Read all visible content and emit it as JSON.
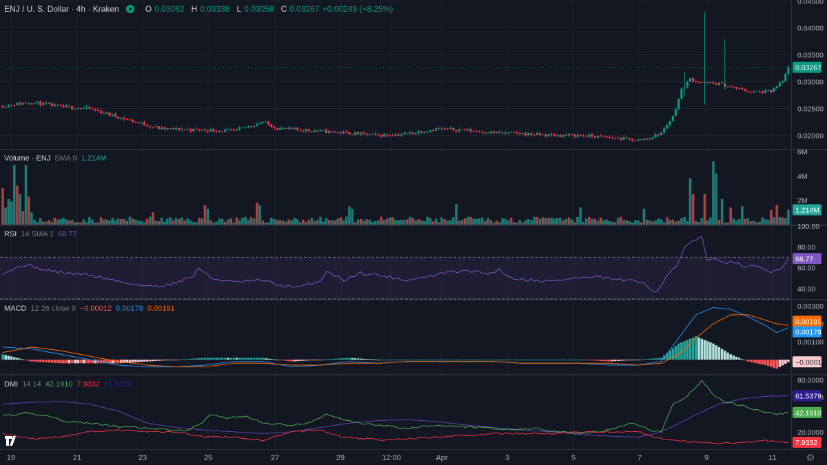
{
  "header": {
    "symbol": "ENJ / U. S. Dollar · 4h · Kraken",
    "o_label": "O",
    "o_value": "0.03062",
    "h_label": "H",
    "h_value": "0.03338",
    "l_label": "L",
    "l_value": "0.03058",
    "c_label": "C",
    "c_value": "0.03267",
    "change": "+0.00249 (+8.25%)"
  },
  "volume_header": {
    "title": "Volume · ENJ",
    "params": "SMA 9",
    "value": "1.214M"
  },
  "rsi_header": {
    "title": "RSI",
    "params": "14 SMA 1",
    "value": "68.77"
  },
  "macd_header": {
    "title": "MACD",
    "params": "12 26 close 9",
    "v1": "−0.00012",
    "v2": "0.00178",
    "v3": "0.00191"
  },
  "dmi_header": {
    "title": "DMI",
    "params": "14 14",
    "v1": "42.1910",
    "v2": "7.9332",
    "v3": "61.5379"
  },
  "colors": {
    "up": "#26a69a",
    "down": "#ef5350",
    "up_candle": "#089981",
    "down_candle": "#f23645",
    "rsi": "#7e57c2",
    "macd": "#2196f3",
    "signal": "#ff6d00",
    "adx": "#311b92",
    "diplus": "#4caf50",
    "diminus": "#f23645"
  },
  "icons": {
    "logo": "tradingview-logo-icon",
    "settings": "gear-icon"
  },
  "chart_data": [
    {
      "type": "candlestick",
      "name": "price",
      "y_axis_ticks": [
        "0.04500",
        "0.04000",
        "0.03500",
        "0.03000",
        "0.02500",
        "0.02000"
      ],
      "ylim": [
        0.0175,
        0.0452
      ],
      "last_price_label": "0.03267",
      "last_price": 0.03267,
      "anchors": [
        [
          0,
          0.0255
        ],
        [
          10,
          0.0262
        ],
        [
          20,
          0.0253
        ],
        [
          30,
          0.025
        ],
        [
          40,
          0.0234
        ],
        [
          55,
          0.0212
        ],
        [
          70,
          0.021
        ],
        [
          80,
          0.0208
        ],
        [
          90,
          0.0225
        ],
        [
          95,
          0.0213
        ],
        [
          110,
          0.0208
        ],
        [
          120,
          0.0204
        ],
        [
          130,
          0.02
        ],
        [
          140,
          0.0203
        ],
        [
          150,
          0.0212
        ],
        [
          160,
          0.021
        ],
        [
          170,
          0.0205
        ],
        [
          180,
          0.0203
        ],
        [
          190,
          0.02
        ],
        [
          200,
          0.02
        ],
        [
          210,
          0.0196
        ],
        [
          220,
          0.0191
        ],
        [
          224,
          0.0195
        ],
        [
          228,
          0.0205
        ],
        [
          232,
          0.0235
        ],
        [
          235,
          0.0285
        ],
        [
          238,
          0.0305
        ],
        [
          242,
          0.0298
        ],
        [
          248,
          0.0296
        ],
        [
          252,
          0.029
        ],
        [
          260,
          0.028
        ],
        [
          266,
          0.0282
        ],
        [
          270,
          0.03
        ],
        [
          272,
          0.0327
        ]
      ],
      "extra_wicks": [
        [
          236,
          0.0318,
          0.0272
        ],
        [
          243,
          0.043,
          0.0258
        ],
        [
          250,
          0.0378,
          0.0285
        ]
      ]
    },
    {
      "type": "bar",
      "name": "volume",
      "y_axis_ticks": [
        "6M",
        "4M",
        "2M"
      ],
      "ylim": [
        0,
        6000000
      ],
      "last_value_label": "1.214M",
      "values_pattern_m": [
        2.8,
        1.4,
        2.1,
        1.7,
        4.9,
        3.2,
        2.5,
        1.1,
        0.9,
        0.7,
        0.5,
        0.4
      ],
      "spikes_m": [
        [
          0,
          3.0
        ],
        [
          3,
          1.9
        ],
        [
          8,
          4.9
        ],
        [
          9,
          2.3
        ],
        [
          10,
          1.0
        ],
        [
          52,
          1.0
        ],
        [
          70,
          1.6
        ],
        [
          71,
          1.3
        ],
        [
          88,
          1.8
        ],
        [
          89,
          1.6
        ],
        [
          120,
          1.5
        ],
        [
          121,
          1.3
        ],
        [
          157,
          1.7
        ],
        [
          200,
          1.4
        ],
        [
          222,
          1.3
        ],
        [
          238,
          3.8
        ],
        [
          239,
          2.5
        ],
        [
          243,
          2.5
        ],
        [
          246,
          5.2
        ],
        [
          247,
          4.2
        ],
        [
          249,
          2.1
        ],
        [
          252,
          1.4
        ],
        [
          256,
          1.5
        ],
        [
          266,
          1.2
        ],
        [
          268,
          1.6
        ],
        [
          272,
          1.214
        ]
      ]
    },
    {
      "type": "line",
      "name": "RSI",
      "y_axis_ticks": [
        "100.00",
        "80.00",
        "60.00",
        "40.00"
      ],
      "ylim": [
        0,
        100
      ],
      "band": [
        30,
        70
      ],
      "last_value_label": "68.77",
      "anchors": [
        [
          0,
          55
        ],
        [
          4,
          59
        ],
        [
          8,
          63
        ],
        [
          14,
          58
        ],
        [
          22,
          55
        ],
        [
          30,
          53
        ],
        [
          40,
          47
        ],
        [
          50,
          42
        ],
        [
          58,
          44
        ],
        [
          66,
          52
        ],
        [
          68,
          60
        ],
        [
          72,
          50
        ],
        [
          80,
          46
        ],
        [
          90,
          48
        ],
        [
          96,
          43
        ],
        [
          102,
          41
        ],
        [
          110,
          47
        ],
        [
          112,
          57
        ],
        [
          118,
          48
        ],
        [
          124,
          55
        ],
        [
          132,
          52
        ],
        [
          140,
          48
        ],
        [
          148,
          52
        ],
        [
          155,
          56
        ],
        [
          162,
          57
        ],
        [
          168,
          54
        ],
        [
          172,
          58
        ],
        [
          176,
          50
        ],
        [
          184,
          48
        ],
        [
          190,
          47
        ],
        [
          198,
          50
        ],
        [
          206,
          51
        ],
        [
          214,
          48
        ],
        [
          222,
          46
        ],
        [
          226,
          36
        ],
        [
          230,
          52
        ],
        [
          234,
          64
        ],
        [
          236,
          79
        ],
        [
          239,
          85
        ],
        [
          242,
          90
        ],
        [
          244,
          68
        ],
        [
          248,
          67
        ],
        [
          252,
          65
        ],
        [
          256,
          62
        ],
        [
          262,
          60
        ],
        [
          266,
          55
        ],
        [
          270,
          61
        ],
        [
          272,
          68.77
        ]
      ]
    },
    {
      "type": "line+bar",
      "name": "MACD",
      "y_axis_ticks": [
        "0.00300",
        "0.00200",
        "0.00100"
      ],
      "ylim": [
        -0.0008,
        0.0033
      ],
      "last_value_labels": [
        "0.00191",
        "0.00178",
        "−0.00012"
      ],
      "macd_last": 0.00178,
      "signal_last": 0.00191,
      "hist_last": -0.00012,
      "macd_anchors": [
        [
          0,
          0.0007
        ],
        [
          10,
          0.0006
        ],
        [
          20,
          0.0003
        ],
        [
          30,
          0.0
        ],
        [
          40,
          -0.0003
        ],
        [
          50,
          -0.0004
        ],
        [
          60,
          -0.0004
        ],
        [
          70,
          -0.0003
        ],
        [
          80,
          -0.0001
        ],
        [
          90,
          -0.0001
        ],
        [
          100,
          -0.0004
        ],
        [
          110,
          -0.0003
        ],
        [
          120,
          -0.0001
        ],
        [
          130,
          -0.0002
        ],
        [
          140,
          -0.0001
        ],
        [
          150,
          -0.0001
        ],
        [
          160,
          -0.0001
        ],
        [
          170,
          -0.0001
        ],
        [
          180,
          -0.0002
        ],
        [
          190,
          -0.0002
        ],
        [
          200,
          -0.0002
        ],
        [
          210,
          -0.0003
        ],
        [
          220,
          -0.0003
        ],
        [
          228,
          -0.0001
        ],
        [
          234,
          0.0012
        ],
        [
          240,
          0.0025
        ],
        [
          246,
          0.0029
        ],
        [
          252,
          0.0028
        ],
        [
          258,
          0.0024
        ],
        [
          264,
          0.0019
        ],
        [
          268,
          0.0015
        ],
        [
          272,
          0.00178
        ]
      ],
      "signal_anchors": [
        [
          0,
          0.0004
        ],
        [
          10,
          0.0007
        ],
        [
          20,
          0.0005
        ],
        [
          30,
          0.0002
        ],
        [
          40,
          -0.0001
        ],
        [
          50,
          -0.0003
        ],
        [
          60,
          -0.0004
        ],
        [
          70,
          -0.0004
        ],
        [
          80,
          -0.0002
        ],
        [
          90,
          -0.0002
        ],
        [
          100,
          -0.0003
        ],
        [
          110,
          -0.0003
        ],
        [
          120,
          -0.0002
        ],
        [
          130,
          -0.0002
        ],
        [
          140,
          -0.0001
        ],
        [
          150,
          -0.0001
        ],
        [
          160,
          -0.0001
        ],
        [
          170,
          -0.0001
        ],
        [
          180,
          -0.0002
        ],
        [
          190,
          -0.0002
        ],
        [
          200,
          -0.0002
        ],
        [
          210,
          -0.0002
        ],
        [
          220,
          -0.0003
        ],
        [
          228,
          -0.0002
        ],
        [
          234,
          0.0003
        ],
        [
          240,
          0.0012
        ],
        [
          246,
          0.002
        ],
        [
          252,
          0.0025
        ],
        [
          258,
          0.0025
        ],
        [
          264,
          0.0022
        ],
        [
          268,
          0.002
        ],
        [
          272,
          0.00191
        ]
      ]
    },
    {
      "type": "line",
      "name": "DMI",
      "y_axis_ticks": [
        "80.0000",
        "60.0000",
        "20.0000"
      ],
      "ylim": [
        0,
        85
      ],
      "last_value_labels": [
        "61.5379",
        "42.1910",
        "7.9332"
      ],
      "adx_anchors": [
        [
          0,
          52
        ],
        [
          10,
          54
        ],
        [
          20,
          55
        ],
        [
          30,
          52
        ],
        [
          40,
          44
        ],
        [
          50,
          30
        ],
        [
          60,
          25
        ],
        [
          70,
          22
        ],
        [
          80,
          20
        ],
        [
          90,
          18
        ],
        [
          100,
          20
        ],
        [
          110,
          25
        ],
        [
          120,
          30
        ],
        [
          130,
          33
        ],
        [
          140,
          34
        ],
        [
          150,
          32
        ],
        [
          160,
          28
        ],
        [
          170,
          25
        ],
        [
          180,
          22
        ],
        [
          190,
          20
        ],
        [
          200,
          17
        ],
        [
          210,
          15
        ],
        [
          220,
          14
        ],
        [
          226,
          18
        ],
        [
          232,
          26
        ],
        [
          240,
          40
        ],
        [
          248,
          52
        ],
        [
          256,
          58
        ],
        [
          264,
          61
        ],
        [
          272,
          61.5379
        ]
      ],
      "diplus_anchors": [
        [
          0,
          40
        ],
        [
          4,
          38
        ],
        [
          8,
          42
        ],
        [
          16,
          38
        ],
        [
          22,
          32
        ],
        [
          30,
          30
        ],
        [
          40,
          26
        ],
        [
          50,
          24
        ],
        [
          58,
          22
        ],
        [
          64,
          22
        ],
        [
          68,
          28
        ],
        [
          72,
          40
        ],
        [
          78,
          36
        ],
        [
          84,
          38
        ],
        [
          90,
          30
        ],
        [
          100,
          28
        ],
        [
          106,
          30
        ],
        [
          112,
          40
        ],
        [
          118,
          34
        ],
        [
          124,
          30
        ],
        [
          132,
          27
        ],
        [
          140,
          24
        ],
        [
          150,
          28
        ],
        [
          158,
          26
        ],
        [
          166,
          25
        ],
        [
          174,
          22
        ],
        [
          184,
          24
        ],
        [
          192,
          20
        ],
        [
          200,
          18
        ],
        [
          210,
          22
        ],
        [
          218,
          30
        ],
        [
          224,
          22
        ],
        [
          228,
          20
        ],
        [
          232,
          52
        ],
        [
          236,
          58
        ],
        [
          240,
          72
        ],
        [
          242,
          80
        ],
        [
          246,
          62
        ],
        [
          250,
          55
        ],
        [
          256,
          50
        ],
        [
          262,
          44
        ],
        [
          268,
          40
        ],
        [
          272,
          42.191
        ]
      ],
      "diminus_anchors": [
        [
          0,
          18
        ],
        [
          10,
          12
        ],
        [
          20,
          14
        ],
        [
          30,
          20
        ],
        [
          40,
          22
        ],
        [
          50,
          20
        ],
        [
          60,
          20
        ],
        [
          70,
          14
        ],
        [
          80,
          14
        ],
        [
          90,
          10
        ],
        [
          100,
          20
        ],
        [
          110,
          22
        ],
        [
          118,
          14
        ],
        [
          124,
          12
        ],
        [
          132,
          11
        ],
        [
          140,
          12
        ],
        [
          150,
          14
        ],
        [
          160,
          16
        ],
        [
          170,
          18
        ],
        [
          180,
          18
        ],
        [
          190,
          18
        ],
        [
          200,
          20
        ],
        [
          210,
          20
        ],
        [
          220,
          20
        ],
        [
          226,
          14
        ],
        [
          232,
          10
        ],
        [
          240,
          8
        ],
        [
          248,
          7
        ],
        [
          256,
          8
        ],
        [
          264,
          10
        ],
        [
          272,
          7.9332
        ]
      ]
    }
  ],
  "x_axis": {
    "ticks": [
      "19",
      "21",
      "23",
      "25",
      "27",
      "29",
      "12:00",
      "Apr",
      "3",
      "5",
      "7",
      "9",
      "11"
    ]
  }
}
